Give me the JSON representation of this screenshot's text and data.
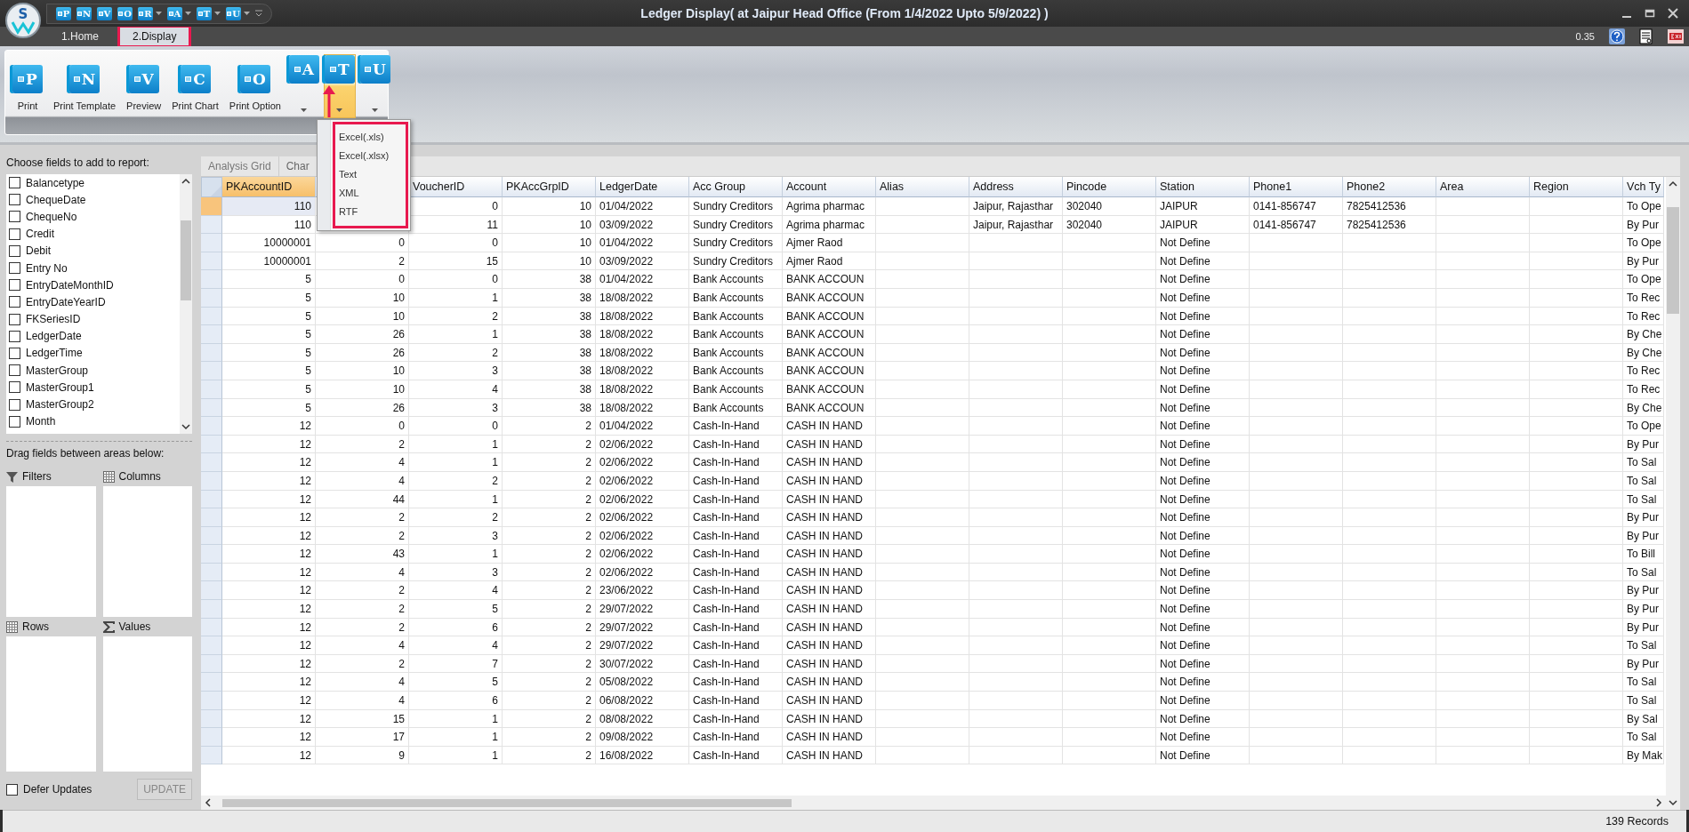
{
  "window": {
    "logo": "S",
    "title": "Ledger Display( at Jaipur Head Office  (From 1/4/2022 Upto 5/9/2022) )",
    "version": "0.35"
  },
  "quick_access": [
    {
      "letter": "P",
      "dropdown": false
    },
    {
      "letter": "N",
      "dropdown": false
    },
    {
      "letter": "V",
      "dropdown": false
    },
    {
      "letter": "O",
      "dropdown": false
    },
    {
      "letter": "R",
      "dropdown": true
    },
    {
      "letter": "A",
      "dropdown": true
    },
    {
      "letter": "T",
      "dropdown": true
    },
    {
      "letter": "U",
      "dropdown": true
    }
  ],
  "tabs": [
    {
      "label": "1.Home",
      "selected": false,
      "highlighted": false
    },
    {
      "label": "2.Display",
      "selected": true,
      "highlighted": true
    }
  ],
  "ribbon": {
    "buttons": [
      {
        "kind": "large",
        "letter": "P",
        "label": "Print"
      },
      {
        "kind": "large",
        "letter": "N",
        "label": "Print Template"
      },
      {
        "kind": "large",
        "letter": "V",
        "label": "Preview"
      },
      {
        "kind": "large",
        "letter": "C",
        "label": "Print Chart"
      },
      {
        "kind": "large",
        "letter": "O",
        "label": "Print Option"
      },
      {
        "kind": "split",
        "letter": "A",
        "selected": false
      },
      {
        "kind": "split",
        "letter": "T",
        "selected": true
      },
      {
        "kind": "split",
        "letter": "U",
        "selected": false
      }
    ]
  },
  "export_menu": {
    "highlighted": true,
    "items": [
      "Excel(.xls)",
      "Excel(.xlsx)",
      "Text",
      "XML",
      "RTF"
    ]
  },
  "field_list": {
    "title": "Choose fields to add to report:",
    "fields": [
      {
        "label": "Balancetype",
        "checked": false
      },
      {
        "label": "ChequeDate",
        "checked": false
      },
      {
        "label": "ChequeNo",
        "checked": false
      },
      {
        "label": "Credit",
        "checked": false
      },
      {
        "label": "Debit",
        "checked": false
      },
      {
        "label": "Entry No",
        "checked": false
      },
      {
        "label": "EntryDateMonthID",
        "checked": false
      },
      {
        "label": "EntryDateYearID",
        "checked": false
      },
      {
        "label": "FKSeriesID",
        "checked": false
      },
      {
        "label": "LedgerDate",
        "checked": false
      },
      {
        "label": "LedgerTime",
        "checked": false
      },
      {
        "label": "MasterGroup",
        "checked": false
      },
      {
        "label": "MasterGroup1",
        "checked": false
      },
      {
        "label": "MasterGroup2",
        "checked": false
      },
      {
        "label": "Month",
        "checked": false
      }
    ]
  },
  "areas": {
    "hint": "Drag fields between areas below:",
    "zones": [
      {
        "kind": "filters",
        "label": "Filters"
      },
      {
        "kind": "columns",
        "label": "Columns"
      },
      {
        "kind": "rows",
        "label": "Rows"
      },
      {
        "kind": "values",
        "label": "Values"
      }
    ]
  },
  "defer_updates": {
    "label": "Defer Updates",
    "checked": false
  },
  "update_button": {
    "label": "UPDATE",
    "disabled": true
  },
  "view_tabs": [
    {
      "label": "Analysis Grid",
      "selected": true
    },
    {
      "label": "Char",
      "selected": false
    }
  ],
  "table": {
    "columns": [
      {
        "label": "PKAccountID",
        "kind": "number",
        "selected": true
      },
      {
        "kind": "number",
        "selected": false
      },
      {
        "label": "VoucherID",
        "kind": "number",
        "selected": false
      },
      {
        "label": "PKAccGrpID",
        "kind": "number",
        "selected": false
      },
      {
        "label": "LedgerDate",
        "kind": "text",
        "selected": false
      },
      {
        "label": "Acc Group",
        "kind": "text",
        "selected": false
      },
      {
        "label": "Account",
        "kind": "text",
        "selected": false
      },
      {
        "label": "Alias",
        "kind": "text",
        "selected": false
      },
      {
        "label": "Address",
        "kind": "text",
        "selected": false
      },
      {
        "label": "Pincode",
        "kind": "text",
        "selected": false
      },
      {
        "label": "Station",
        "kind": "text",
        "selected": false
      },
      {
        "label": "Phone1",
        "kind": "text",
        "selected": false
      },
      {
        "label": "Phone2",
        "kind": "text",
        "selected": false
      },
      {
        "label": "Area",
        "kind": "text",
        "selected": false
      },
      {
        "label": "Region",
        "kind": "text",
        "selected": false
      },
      {
        "label": "Vch Ty",
        "kind": "text",
        "selected": false
      }
    ],
    "rows": [
      {
        "selected": true,
        "cells": [
          "110",
          null,
          "0",
          "10",
          "01/04/2022",
          "Sundry Creditors",
          "Agrima pharmac",
          null,
          "Jaipur, Rajasthar",
          "302040",
          "JAIPUR",
          "0141-856747",
          "7825412536",
          null,
          null,
          "To Ope"
        ]
      },
      {
        "selected": false,
        "cells": [
          "110",
          null,
          "11",
          "10",
          "03/09/2022",
          "Sundry Creditors",
          "Agrima pharmac",
          null,
          "Jaipur, Rajasthar",
          "302040",
          "JAIPUR",
          "0141-856747",
          "7825412536",
          null,
          null,
          "By Pur"
        ]
      },
      {
        "selected": false,
        "cells": [
          "10000001",
          "0",
          "0",
          "10",
          "01/04/2022",
          "Sundry Creditors",
          "Ajmer Raod",
          null,
          null,
          null,
          "Not Define",
          null,
          null,
          null,
          null,
          "To Ope"
        ]
      },
      {
        "selected": false,
        "cells": [
          "10000001",
          "2",
          "15",
          "10",
          "03/09/2022",
          "Sundry Creditors",
          "Ajmer Raod",
          null,
          null,
          null,
          "Not Define",
          null,
          null,
          null,
          null,
          "By Pur"
        ]
      },
      {
        "selected": false,
        "cells": [
          "5",
          "0",
          "0",
          "38",
          "01/04/2022",
          "Bank Accounts",
          "BANK ACCOUN",
          null,
          null,
          null,
          "Not Define",
          null,
          null,
          null,
          null,
          "To Ope"
        ]
      },
      {
        "selected": false,
        "cells": [
          "5",
          "10",
          "1",
          "38",
          "18/08/2022",
          "Bank Accounts",
          "BANK ACCOUN",
          null,
          null,
          null,
          "Not Define",
          null,
          null,
          null,
          null,
          "To Rec"
        ]
      },
      {
        "selected": false,
        "cells": [
          "5",
          "10",
          "2",
          "38",
          "18/08/2022",
          "Bank Accounts",
          "BANK ACCOUN",
          null,
          null,
          null,
          "Not Define",
          null,
          null,
          null,
          null,
          "To Rec"
        ]
      },
      {
        "selected": false,
        "cells": [
          "5",
          "26",
          "1",
          "38",
          "18/08/2022",
          "Bank Accounts",
          "BANK ACCOUN",
          null,
          null,
          null,
          "Not Define",
          null,
          null,
          null,
          null,
          "By Che"
        ]
      },
      {
        "selected": false,
        "cells": [
          "5",
          "26",
          "2",
          "38",
          "18/08/2022",
          "Bank Accounts",
          "BANK ACCOUN",
          null,
          null,
          null,
          "Not Define",
          null,
          null,
          null,
          null,
          "By Che"
        ]
      },
      {
        "selected": false,
        "cells": [
          "5",
          "10",
          "3",
          "38",
          "18/08/2022",
          "Bank Accounts",
          "BANK ACCOUN",
          null,
          null,
          null,
          "Not Define",
          null,
          null,
          null,
          null,
          "To Rec"
        ]
      },
      {
        "selected": false,
        "cells": [
          "5",
          "10",
          "4",
          "38",
          "18/08/2022",
          "Bank Accounts",
          "BANK ACCOUN",
          null,
          null,
          null,
          "Not Define",
          null,
          null,
          null,
          null,
          "To Rec"
        ]
      },
      {
        "selected": false,
        "cells": [
          "5",
          "26",
          "3",
          "38",
          "18/08/2022",
          "Bank Accounts",
          "BANK ACCOUN",
          null,
          null,
          null,
          "Not Define",
          null,
          null,
          null,
          null,
          "By Che"
        ]
      },
      {
        "selected": false,
        "cells": [
          "12",
          "0",
          "0",
          "2",
          "01/04/2022",
          "Cash-In-Hand",
          "CASH IN HAND",
          null,
          null,
          null,
          "Not Define",
          null,
          null,
          null,
          null,
          "To Ope"
        ]
      },
      {
        "selected": false,
        "cells": [
          "12",
          "2",
          "1",
          "2",
          "02/06/2022",
          "Cash-In-Hand",
          "CASH IN HAND",
          null,
          null,
          null,
          "Not Define",
          null,
          null,
          null,
          null,
          "By Pur"
        ]
      },
      {
        "selected": false,
        "cells": [
          "12",
          "4",
          "1",
          "2",
          "02/06/2022",
          "Cash-In-Hand",
          "CASH IN HAND",
          null,
          null,
          null,
          "Not Define",
          null,
          null,
          null,
          null,
          "To Sal"
        ]
      },
      {
        "selected": false,
        "cells": [
          "12",
          "4",
          "2",
          "2",
          "02/06/2022",
          "Cash-In-Hand",
          "CASH IN HAND",
          null,
          null,
          null,
          "Not Define",
          null,
          null,
          null,
          null,
          "To Sal"
        ]
      },
      {
        "selected": false,
        "cells": [
          "12",
          "44",
          "1",
          "2",
          "02/06/2022",
          "Cash-In-Hand",
          "CASH IN HAND",
          null,
          null,
          null,
          "Not Define",
          null,
          null,
          null,
          null,
          "To Sal"
        ]
      },
      {
        "selected": false,
        "cells": [
          "12",
          "2",
          "2",
          "2",
          "02/06/2022",
          "Cash-In-Hand",
          "CASH IN HAND",
          null,
          null,
          null,
          "Not Define",
          null,
          null,
          null,
          null,
          "By Pur"
        ]
      },
      {
        "selected": false,
        "cells": [
          "12",
          "2",
          "3",
          "2",
          "02/06/2022",
          "Cash-In-Hand",
          "CASH IN HAND",
          null,
          null,
          null,
          "Not Define",
          null,
          null,
          null,
          null,
          "By Pur"
        ]
      },
      {
        "selected": false,
        "cells": [
          "12",
          "43",
          "1",
          "2",
          "02/06/2022",
          "Cash-In-Hand",
          "CASH IN HAND",
          null,
          null,
          null,
          "Not Define",
          null,
          null,
          null,
          null,
          "To Bill"
        ]
      },
      {
        "selected": false,
        "cells": [
          "12",
          "4",
          "3",
          "2",
          "02/06/2022",
          "Cash-In-Hand",
          "CASH IN HAND",
          null,
          null,
          null,
          "Not Define",
          null,
          null,
          null,
          null,
          "To Sal"
        ]
      },
      {
        "selected": false,
        "cells": [
          "12",
          "2",
          "4",
          "2",
          "23/06/2022",
          "Cash-In-Hand",
          "CASH IN HAND",
          null,
          null,
          null,
          "Not Define",
          null,
          null,
          null,
          null,
          "By Pur"
        ]
      },
      {
        "selected": false,
        "cells": [
          "12",
          "2",
          "5",
          "2",
          "29/07/2022",
          "Cash-In-Hand",
          "CASH IN HAND",
          null,
          null,
          null,
          "Not Define",
          null,
          null,
          null,
          null,
          "By Pur"
        ]
      },
      {
        "selected": false,
        "cells": [
          "12",
          "2",
          "6",
          "2",
          "29/07/2022",
          "Cash-In-Hand",
          "CASH IN HAND",
          null,
          null,
          null,
          "Not Define",
          null,
          null,
          null,
          null,
          "By Pur"
        ]
      },
      {
        "selected": false,
        "cells": [
          "12",
          "4",
          "4",
          "2",
          "29/07/2022",
          "Cash-In-Hand",
          "CASH IN HAND",
          null,
          null,
          null,
          "Not Define",
          null,
          null,
          null,
          null,
          "To Sal"
        ]
      },
      {
        "selected": false,
        "cells": [
          "12",
          "2",
          "7",
          "2",
          "30/07/2022",
          "Cash-In-Hand",
          "CASH IN HAND",
          null,
          null,
          null,
          "Not Define",
          null,
          null,
          null,
          null,
          "By Pur"
        ]
      },
      {
        "selected": false,
        "cells": [
          "12",
          "4",
          "5",
          "2",
          "05/08/2022",
          "Cash-In-Hand",
          "CASH IN HAND",
          null,
          null,
          null,
          "Not Define",
          null,
          null,
          null,
          null,
          "To Sal"
        ]
      },
      {
        "selected": false,
        "cells": [
          "12",
          "4",
          "6",
          "2",
          "06/08/2022",
          "Cash-In-Hand",
          "CASH IN HAND",
          null,
          null,
          null,
          "Not Define",
          null,
          null,
          null,
          null,
          "To Sal"
        ]
      },
      {
        "selected": false,
        "cells": [
          "12",
          "15",
          "1",
          "2",
          "08/08/2022",
          "Cash-In-Hand",
          "CASH IN HAND",
          null,
          null,
          null,
          "Not Define",
          null,
          null,
          null,
          null,
          "By Sal"
        ]
      },
      {
        "selected": false,
        "cells": [
          "12",
          "17",
          "1",
          "2",
          "09/08/2022",
          "Cash-In-Hand",
          "CASH IN HAND",
          null,
          null,
          null,
          "Not Define",
          null,
          null,
          null,
          null,
          "To Sal"
        ]
      },
      {
        "selected": false,
        "cells": [
          "12",
          "9",
          "1",
          "2",
          "16/08/2022",
          "Cash-In-Hand",
          "CASH IN HAND",
          null,
          null,
          null,
          "Not Define",
          null,
          null,
          null,
          null,
          "By Mak"
        ]
      }
    ]
  },
  "status_bar": {
    "records": "139 Records"
  }
}
